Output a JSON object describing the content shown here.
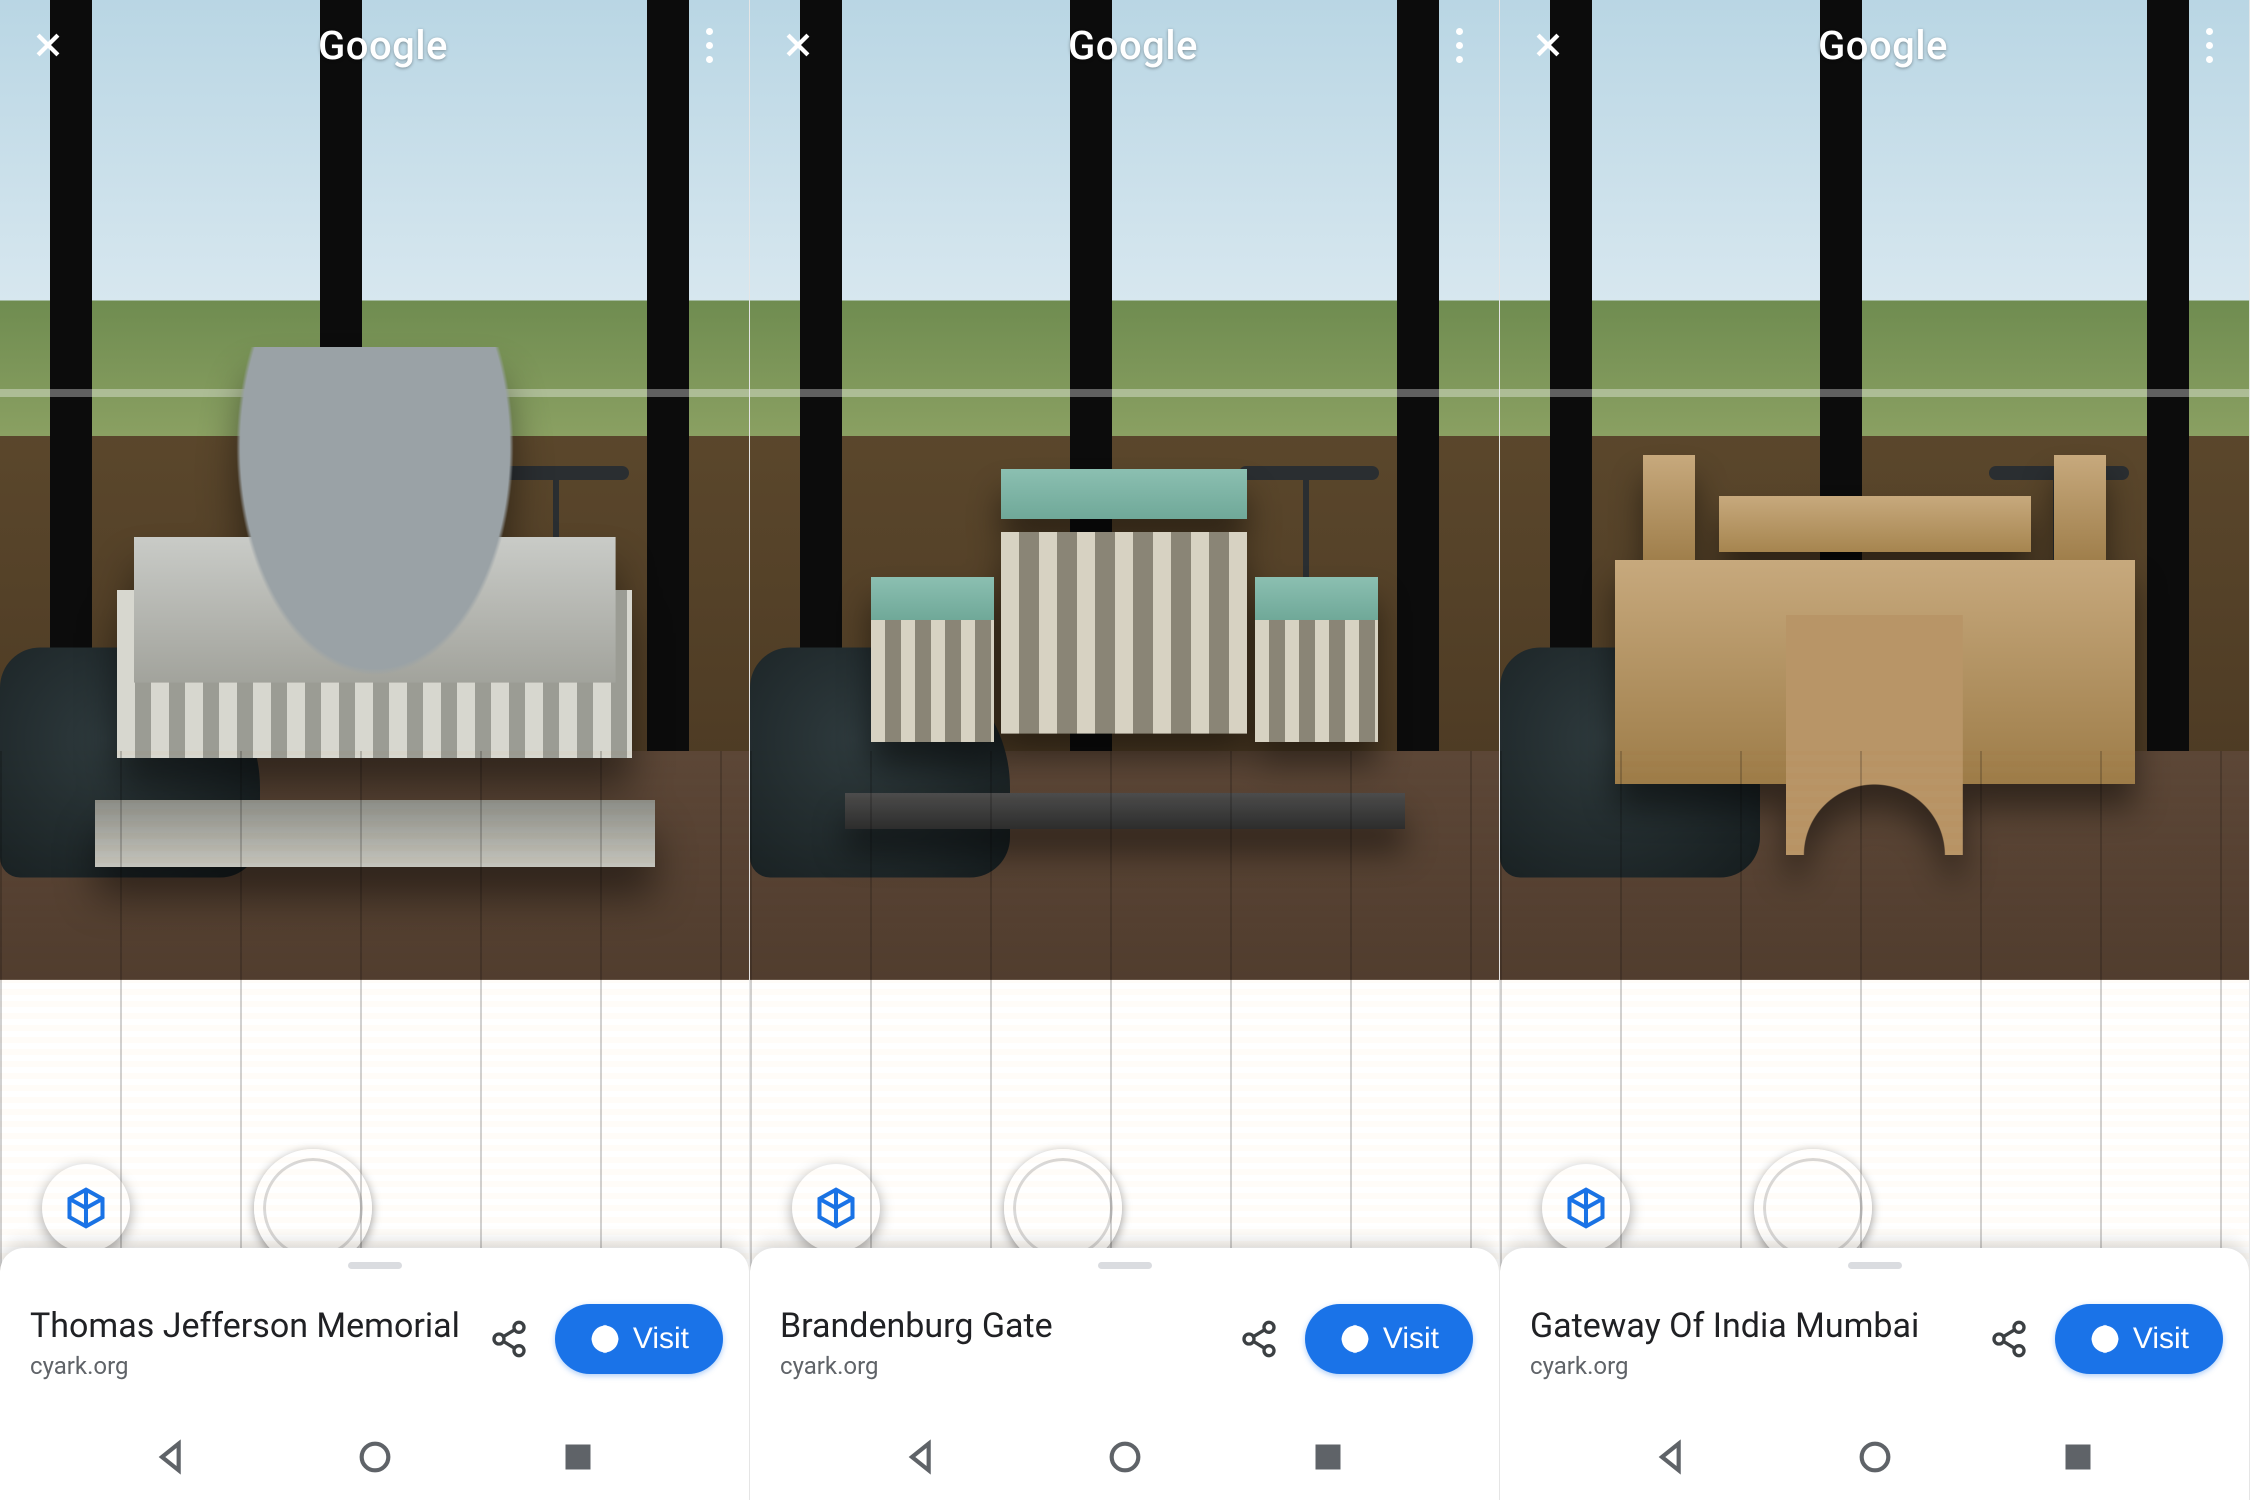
{
  "brand": "Google",
  "buttons": {
    "visit": "Visit"
  },
  "icons": {
    "close": "close-icon",
    "overflow": "overflow-menu-icon",
    "view3d": "cube-3d-icon",
    "shutter": "camera-shutter-icon",
    "share": "share-icon",
    "globe": "globe-icon",
    "navBack": "nav-back-icon",
    "navHome": "nav-home-icon",
    "navRecent": "nav-recent-icon"
  },
  "colors": {
    "accent": "#1a73e8"
  },
  "screens": [
    {
      "title": "Thomas Jefferson Memorial",
      "source": "cyark.org",
      "model": "jefferson"
    },
    {
      "title": "Brandenburg Gate",
      "source": "cyark.org",
      "model": "brandenburg"
    },
    {
      "title": "Gateway Of India Mumbai",
      "source": "cyark.org",
      "model": "gateway"
    }
  ]
}
